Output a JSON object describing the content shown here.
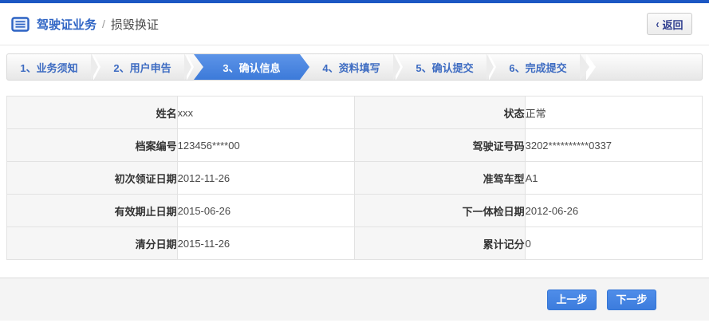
{
  "header": {
    "title": "驾驶证业务",
    "separator": "/",
    "subtitle": "损毁换证",
    "back_chevron": "‹",
    "back_label": "返回"
  },
  "steps": {
    "active_index": 2,
    "items": [
      {
        "label": "1、业务须知"
      },
      {
        "label": "2、用户申告"
      },
      {
        "label": "3、确认信息"
      },
      {
        "label": "4、资料填写"
      },
      {
        "label": "5、确认提交"
      },
      {
        "label": "6、完成提交"
      }
    ]
  },
  "table": {
    "rows": [
      {
        "label_left": "姓名",
        "value_left": "xxx",
        "label_right": "状态",
        "value_right": "正常"
      },
      {
        "label_left": "档案编号",
        "value_left": "123456****00",
        "label_right": "驾驶证号码",
        "value_right": "3202**********0337"
      },
      {
        "label_left": "初次领证日期",
        "value_left": "2012-11-26",
        "label_right": "准驾车型",
        "value_right": "A1"
      },
      {
        "label_left": "有效期止日期",
        "value_left": "2015-06-26",
        "label_right": "下一体检日期",
        "value_right": "2012-06-26"
      },
      {
        "label_left": "清分日期",
        "value_left": "2015-11-26",
        "label_right": "累计记分",
        "value_right": "0"
      }
    ]
  },
  "footer": {
    "prev_label": "上一步",
    "next_label": "下一步"
  },
  "colors": {
    "topbar_blue": "#1c57c3",
    "accent_blue": "#2e64c4",
    "step_active_blue": "#4484e0",
    "button_blue": "#4486e6",
    "back_text_navy": "#2f3e8f",
    "label_cell_bg": "#f6f6f6",
    "footer_bg": "#f4f4f4"
  }
}
